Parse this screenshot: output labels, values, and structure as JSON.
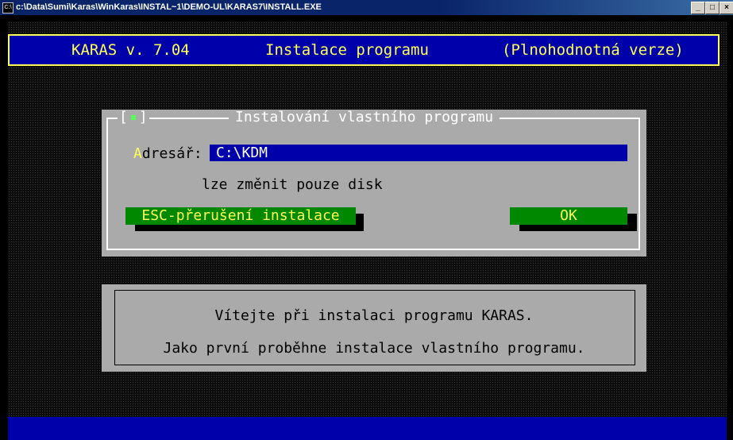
{
  "window": {
    "title": "c:\\Data\\Sumi\\Karas\\WinKaras\\INSTAL~1\\DEMO-UL\\KARAS7\\INSTALL.EXE",
    "icon_text": "C:\\",
    "minimize": "_",
    "maximize": "□",
    "close": "×"
  },
  "header": {
    "left": "KARAS v. 7.04",
    "center": "Instalace programu",
    "right": "(Plnohodnotná verze)"
  },
  "dialog": {
    "title": "Instalování vlastního programu",
    "close_left": "[",
    "close_right": "]",
    "dir_label_hot": "A",
    "dir_label_rest": "dresář:",
    "dir_value": "C:\\KDM",
    "hint": "lze změnit pouze disk",
    "cancel_label": "ESC-přerušení instalace",
    "ok_label": "OK"
  },
  "welcome": {
    "line1": "Vítejte při instalaci programu KARAS.",
    "line2": "Jako první proběhne instalace vlastního programu."
  },
  "colors": {
    "header_bg": "#0000aa",
    "header_fg": "#ffff55",
    "dialog_bg": "#aaaaaa",
    "button_bg": "#008800",
    "input_bg": "#0000aa"
  }
}
